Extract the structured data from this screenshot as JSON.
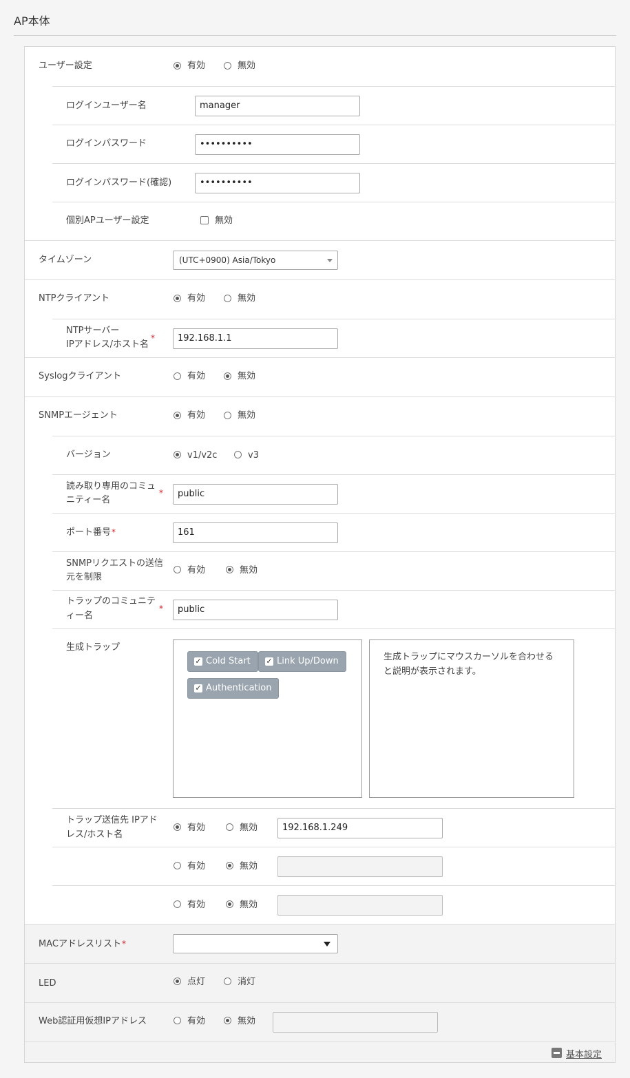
{
  "page_title": "AP本体",
  "opt": {
    "enable": "有効",
    "disable": "無効"
  },
  "user_settings": {
    "label": "ユーザー設定",
    "login_user": {
      "label": "ログインユーザー名",
      "value": "manager"
    },
    "login_password": {
      "label": "ログインパスワード",
      "value": "••••••••••"
    },
    "login_password_confirm": {
      "label": "ログインパスワード(確認)",
      "value": "••••••••••"
    },
    "individual": {
      "label": "個別APユーザー設定",
      "checkbox_label": "無効"
    }
  },
  "timezone": {
    "label": "タイムゾーン",
    "value": "(UTC+0900) Asia/Tokyo"
  },
  "ntp": {
    "label": "NTPクライアント",
    "server_label_1": "NTPサーバー",
    "server_label_2": "IPアドレス/ホスト名",
    "server_value": "192.168.1.1"
  },
  "syslog": {
    "label": "Syslogクライアント"
  },
  "snmp": {
    "label": "SNMPエージェント",
    "version": {
      "label": "バージョン",
      "opt1": "v1/v2c",
      "opt2": "v3"
    },
    "ro_community": {
      "label_1": "読み取り専用のコミュ",
      "label_2": "ニティー名",
      "value": "public"
    },
    "port": {
      "label": "ポート番号",
      "value": "161"
    },
    "restrict": {
      "label_1": "SNMPリクエストの送信",
      "label_2": "元を制限"
    },
    "trap_community": {
      "label_1": "トラップのコミュニテ",
      "label_2": "ィー名",
      "value": "public"
    },
    "traps": {
      "label": "生成トラップ",
      "items": [
        "Cold Start",
        "Link Up/Down",
        "Authentication"
      ],
      "description_1": "生成トラップにマウスカーソルを合わせる",
      "description_2": "と説明が表示されます。"
    },
    "trap_dest": {
      "label_1": "トラップ送信先 IPアド",
      "label_2": "レス/ホスト名",
      "values": [
        "192.168.1.249",
        "",
        ""
      ]
    }
  },
  "mac_list": {
    "label": "MACアドレスリスト",
    "value": ""
  },
  "led": {
    "label": "LED",
    "on": "点灯",
    "off": "消灯"
  },
  "web_auth": {
    "label": "Web認証用仮想IPアドレス",
    "value": ""
  },
  "footer": {
    "link": "基本設定"
  },
  "required_mark": "*",
  "checkmark": "✓"
}
